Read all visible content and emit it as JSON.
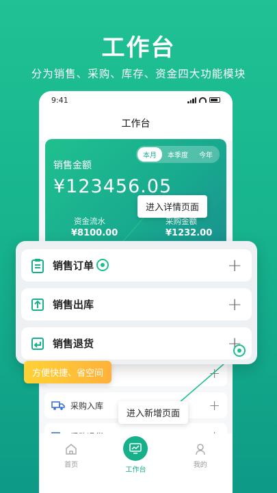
{
  "hero": {
    "title": "工作台",
    "subtitle": "分为销售、采购、库存、资金四大功能模块"
  },
  "status_bar": {
    "time": "9:41"
  },
  "nav": {
    "title": "工作台"
  },
  "sales_card": {
    "period_tabs": [
      "本月",
      "本季度",
      "今年"
    ],
    "active_period": "本月",
    "label": "销售金额",
    "amount": "¥123456.05",
    "cash_flow_label": "资金流水",
    "cash_flow_value": "¥8100.00",
    "purchase_label": "采购金额",
    "purchase_value": "¥1232.00"
  },
  "popup_rows": [
    {
      "label": "销售订单",
      "icon": "clipboard-icon"
    },
    {
      "label": "销售出库",
      "icon": "upload-box-icon"
    },
    {
      "label": "销售退货",
      "icon": "return-box-icon"
    }
  ],
  "callouts": {
    "detail": "进入详情页面",
    "new": "进入新增页面"
  },
  "badge": "方便快捷、省空间",
  "small_rows": [
    {
      "label": "采购入库",
      "icon": "truck-icon"
    },
    {
      "label": "采购退货",
      "icon": "truck-return-icon"
    }
  ],
  "tabbar": {
    "home": "首页",
    "workbench": "工作台",
    "mine": "我的"
  },
  "colors": {
    "brand": "#16b08a",
    "badge": "#ffc23a"
  }
}
